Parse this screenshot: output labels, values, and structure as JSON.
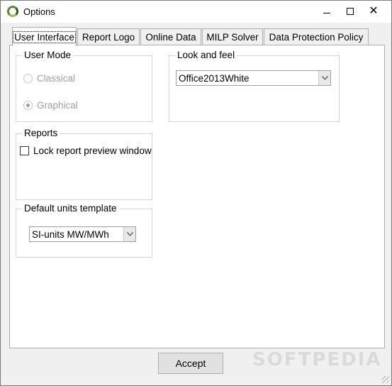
{
  "window": {
    "title": "Options",
    "minimize_glyph": "",
    "close_glyph": "✕"
  },
  "tabs": [
    {
      "label": "User Interface",
      "active": true
    },
    {
      "label": "Report Logo",
      "active": false
    },
    {
      "label": "Online Data",
      "active": false
    },
    {
      "label": "MILP Solver",
      "active": false
    },
    {
      "label": "Data Protection Policy",
      "active": false
    }
  ],
  "user_mode": {
    "legend": "User Mode",
    "options": [
      {
        "label": "Classical",
        "checked": false,
        "enabled": false
      },
      {
        "label": "Graphical",
        "checked": true,
        "enabled": false
      }
    ]
  },
  "look_and_feel": {
    "legend": "Look and feel",
    "selected": "Office2013White"
  },
  "reports": {
    "legend": "Reports",
    "lock_preview_label": "Lock report preview window",
    "lock_preview_checked": false
  },
  "default_units": {
    "legend": "Default units template",
    "selected": "SI-units MW/MWh"
  },
  "footer": {
    "accept_label": "Accept",
    "watermark": "SOFTPEDIA"
  }
}
